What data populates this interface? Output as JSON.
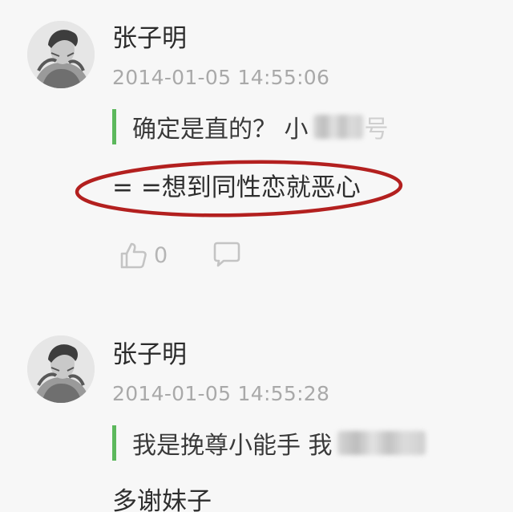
{
  "comments": [
    {
      "author": "张子明",
      "timestamp": "2014-01-05 14:55:06",
      "quoted_text": "确定是直的？ 小",
      "quoted_blurred_tail": "号",
      "reply_text": "= =想到同性恋就恶心",
      "likes": "0",
      "reply_highlighted": true
    },
    {
      "author": "张子明",
      "timestamp": "2014-01-05 14:55:28",
      "quoted_text": "我是挽尊小能手 我",
      "reply_text": "多谢妹子"
    }
  ],
  "icons": {
    "like": "thumbs-up-icon",
    "comment": "comment-bubble-icon"
  },
  "colors": {
    "quote_bar": "#5cb85c",
    "timestamp": "#a9a9a9",
    "highlight_ring": "#b3201f",
    "icon_gray": "#c4c4c4"
  }
}
